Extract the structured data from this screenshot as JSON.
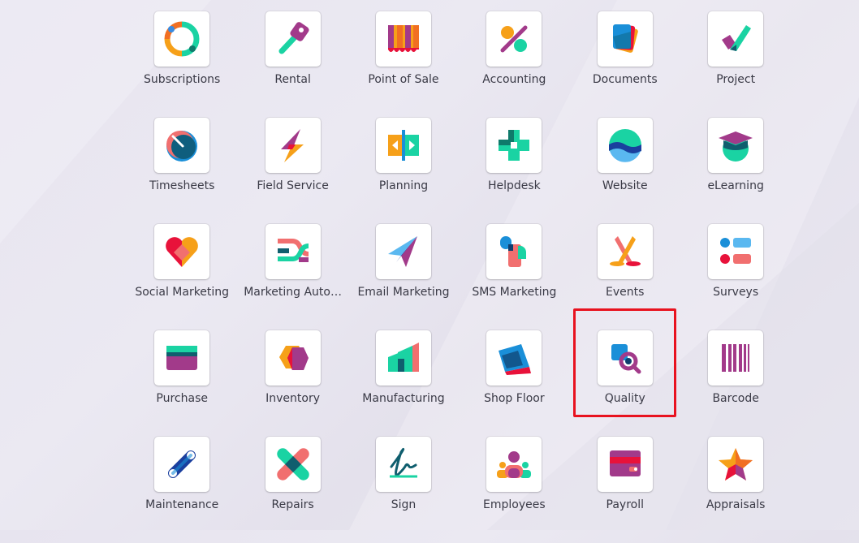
{
  "apps": [
    {
      "label": "Subscriptions",
      "icon": "subscriptions-icon"
    },
    {
      "label": "Rental",
      "icon": "rental-icon"
    },
    {
      "label": "Point of Sale",
      "icon": "point-of-sale-icon"
    },
    {
      "label": "Accounting",
      "icon": "accounting-icon"
    },
    {
      "label": "Documents",
      "icon": "documents-icon"
    },
    {
      "label": "Project",
      "icon": "project-icon"
    },
    {
      "label": "Timesheets",
      "icon": "timesheets-icon"
    },
    {
      "label": "Field Service",
      "icon": "field-service-icon"
    },
    {
      "label": "Planning",
      "icon": "planning-icon"
    },
    {
      "label": "Helpdesk",
      "icon": "helpdesk-icon"
    },
    {
      "label": "Website",
      "icon": "website-icon"
    },
    {
      "label": "eLearning",
      "icon": "elearning-icon"
    },
    {
      "label": "Social Marketing",
      "icon": "social-marketing-icon"
    },
    {
      "label": "Marketing Auto…",
      "icon": "marketing-automation-icon"
    },
    {
      "label": "Email Marketing",
      "icon": "email-marketing-icon"
    },
    {
      "label": "SMS Marketing",
      "icon": "sms-marketing-icon"
    },
    {
      "label": "Events",
      "icon": "events-icon"
    },
    {
      "label": "Surveys",
      "icon": "surveys-icon"
    },
    {
      "label": "Purchase",
      "icon": "purchase-icon"
    },
    {
      "label": "Inventory",
      "icon": "inventory-icon"
    },
    {
      "label": "Manufacturing",
      "icon": "manufacturing-icon"
    },
    {
      "label": "Shop Floor",
      "icon": "shop-floor-icon"
    },
    {
      "label": "Quality",
      "icon": "quality-icon"
    },
    {
      "label": "Barcode",
      "icon": "barcode-icon"
    },
    {
      "label": "Maintenance",
      "icon": "maintenance-icon"
    },
    {
      "label": "Repairs",
      "icon": "repairs-icon"
    },
    {
      "label": "Sign",
      "icon": "sign-icon"
    },
    {
      "label": "Employees",
      "icon": "employees-icon"
    },
    {
      "label": "Payroll",
      "icon": "payroll-icon"
    },
    {
      "label": "Appraisals",
      "icon": "appraisals-icon"
    }
  ],
  "highlighted_app": "Quality",
  "highlight_color": "#e8121f"
}
